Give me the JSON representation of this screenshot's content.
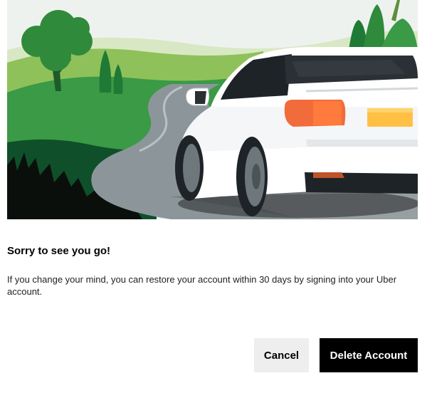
{
  "dialog": {
    "title": "Sorry to see you go!",
    "message": "If you change your mind, you can restore your account within 30 days by signing into your Uber account.",
    "cancel_label": "Cancel",
    "delete_label": "Delete Account"
  },
  "illustration": {
    "subject": "white-car-on-winding-road",
    "colors": {
      "sky": "#eef2ef",
      "hill_light": "#8fc15a",
      "hill_dark": "#2f8a3b",
      "forest": "#0f4f2a",
      "road": "#8c969a",
      "car_body": "#ffffff",
      "tail_light": "#f26b3a",
      "plate": "#ffc043"
    }
  },
  "theme": {
    "primary_button_bg": "#000000",
    "secondary_button_bg": "#eeeeee"
  }
}
